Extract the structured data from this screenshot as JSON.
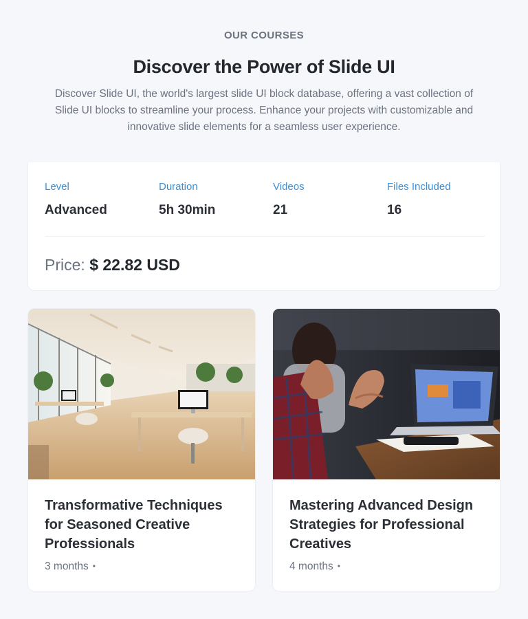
{
  "header": {
    "eyebrow": "OUR COURSES",
    "title": "Discover the Power of Slide UI",
    "description": "Discover Slide UI, the world's largest slide UI block database, offering a vast collection of Slide UI blocks to streamline your process. Enhance your projects with customizable and innovative slide elements for a seamless user experience."
  },
  "course_info": {
    "stats": [
      {
        "label": "Level",
        "value": "Advanced"
      },
      {
        "label": "Duration",
        "value": "5h 30min"
      },
      {
        "label": "Videos",
        "value": "21"
      },
      {
        "label": "Files Included",
        "value": "16"
      }
    ],
    "price_label": "Price:",
    "price_value": "$ 22.82 USD"
  },
  "courses": [
    {
      "title": "Transformative Techniques for Seasoned Creative Professionals",
      "meta": "3 months",
      "meta_dot": "•",
      "image": "office-interior-photo"
    },
    {
      "title": "Mastering Advanced Design Strategies for Professional Creatives",
      "meta": "4 months",
      "meta_dot": "•",
      "image": "laptop-meeting-photo"
    }
  ],
  "colors": {
    "accent_label": "#3b8fd6",
    "background": "#f6f7fa",
    "muted_text": "#6b7280"
  }
}
